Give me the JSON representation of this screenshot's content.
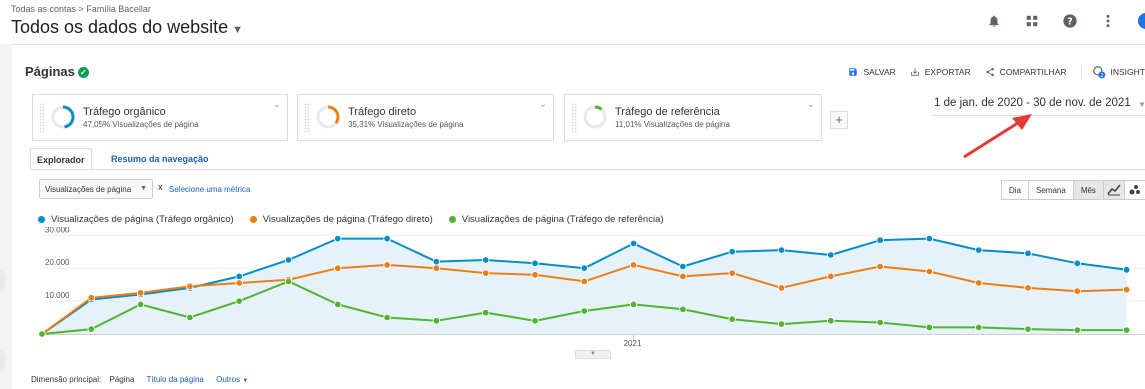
{
  "header": {
    "breadcrumb": "Todas as contas > Família Bacellar",
    "view_name": "Todos os dados do website"
  },
  "page": {
    "title": "Páginas",
    "actions": [
      {
        "icon": "save-icon",
        "label": "SALVAR"
      },
      {
        "icon": "export-icon",
        "label": "EXPORTAR"
      },
      {
        "icon": "share-icon",
        "label": "COMPARTILHAR"
      },
      {
        "icon": "insights-icon",
        "label": "INSIGHT"
      }
    ]
  },
  "segments": [
    {
      "name": "Tráfego orgânico",
      "stat": "47,05% Visualizações de página",
      "color": "#058dc7",
      "share": 0.4705
    },
    {
      "name": "Tráfego direto",
      "stat": "35,31% Visualizações de página",
      "color": "#ed7e17",
      "share": 0.3531
    },
    {
      "name": "Tráfego de referência",
      "stat": "11,01% Visualizações de página",
      "color": "#50b432",
      "share": 0.1101
    }
  ],
  "add_segment": "+",
  "date_range": "1 de jan. de 2020 - 30 de nov. de 2021",
  "tabs": [
    {
      "label": "Explorador",
      "active": true
    },
    {
      "label": "Resumo da navegação",
      "active": false
    }
  ],
  "metric_select": {
    "value": "Visualizações de página",
    "remove": "x",
    "select_link": "Selecione uma métrica"
  },
  "granularity": [
    {
      "label": "Dia",
      "selected": false
    },
    {
      "label": "Semana",
      "selected": false
    },
    {
      "label": "Mês",
      "selected": true
    }
  ],
  "chart_data": {
    "type": "line",
    "x": [
      "2020-01",
      "2020-02",
      "2020-03",
      "2020-04",
      "2020-05",
      "2020-06",
      "2020-07",
      "2020-08",
      "2020-09",
      "2020-10",
      "2020-11",
      "2020-12",
      "2021-01",
      "2021-02",
      "2021-03",
      "2021-04",
      "2021-05",
      "2021-06",
      "2021-07",
      "2021-08",
      "2021-09",
      "2021-10",
      "2021-11",
      "2021-12",
      "2022-01"
    ],
    "x_tick_label": "2021",
    "x_tick_index": 12,
    "y_ticks": [
      "10.000",
      "20.000",
      "30.000"
    ],
    "ylim": [
      0,
      31000
    ],
    "series": [
      {
        "name": "Visualizações de página (Tráfego orgânico)",
        "color": "#058dc7",
        "area": true,
        "values": [
          0,
          10500,
          12000,
          14000,
          17500,
          22500,
          29000,
          29000,
          22000,
          22500,
          21500,
          20000,
          27500,
          20500,
          25000,
          25500,
          24000,
          28500,
          29000,
          25500,
          24500,
          21500,
          19500
        ]
      },
      {
        "name": "Visualizações de página (Tráfego direto)",
        "color": "#ed7e17",
        "area": false,
        "values": [
          0,
          11000,
          12500,
          14500,
          15500,
          16500,
          20000,
          21000,
          20000,
          18500,
          18000,
          16000,
          21000,
          17500,
          18500,
          14000,
          17500,
          20500,
          19000,
          15500,
          14000,
          13000,
          13500
        ]
      },
      {
        "name": "Visualizações de página (Tráfego de referência)",
        "color": "#50b432",
        "area": false,
        "values": [
          0,
          1500,
          9000,
          5000,
          10000,
          16000,
          9000,
          5000,
          4000,
          6500,
          4000,
          7000,
          9000,
          7500,
          4500,
          3000,
          4000,
          3500,
          2000,
          2000,
          1500,
          1200,
          1200
        ]
      }
    ]
  },
  "footer": {
    "label": "Dimensão principal:",
    "current": "Página",
    "links": [
      "Título da página",
      "Outros"
    ]
  }
}
